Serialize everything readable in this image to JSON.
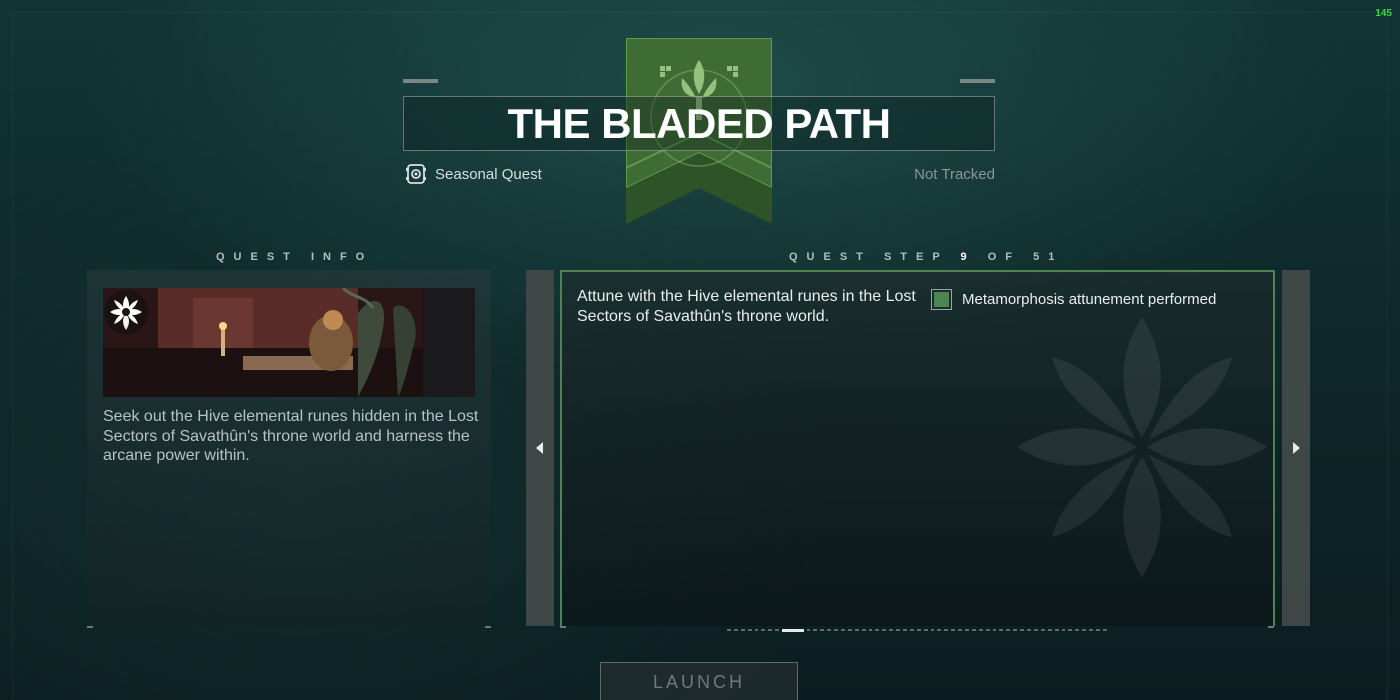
{
  "fps_counter": "145",
  "quest": {
    "title": "THE BLADED PATH",
    "type_label": "Seasonal Quest",
    "track_status": "Not Tracked"
  },
  "quest_info": {
    "header": "QUEST INFO",
    "description": "Seek out the Hive elemental runes hidden in the Lost Sectors of Savathûn's throne world and harness the arcane power within."
  },
  "quest_step": {
    "header_prefix": "QUEST STEP",
    "current": "9",
    "header_of": "OF",
    "total": "51",
    "description": "Attune with the Hive elemental runes in the Lost Sectors of Savathûn's throne world.",
    "objectives": [
      {
        "label": "Metamorphosis attunement performed",
        "complete": true
      }
    ]
  },
  "actions": {
    "launch_label": "LAUNCH"
  },
  "colors": {
    "accent_green": "#4f8352",
    "background": "#123534"
  },
  "icons": {
    "banner": "seasonal-flower-emblem",
    "quest_type": "seasonal-quest-icon",
    "prev": "left-arrow-icon",
    "next": "right-arrow-icon"
  }
}
